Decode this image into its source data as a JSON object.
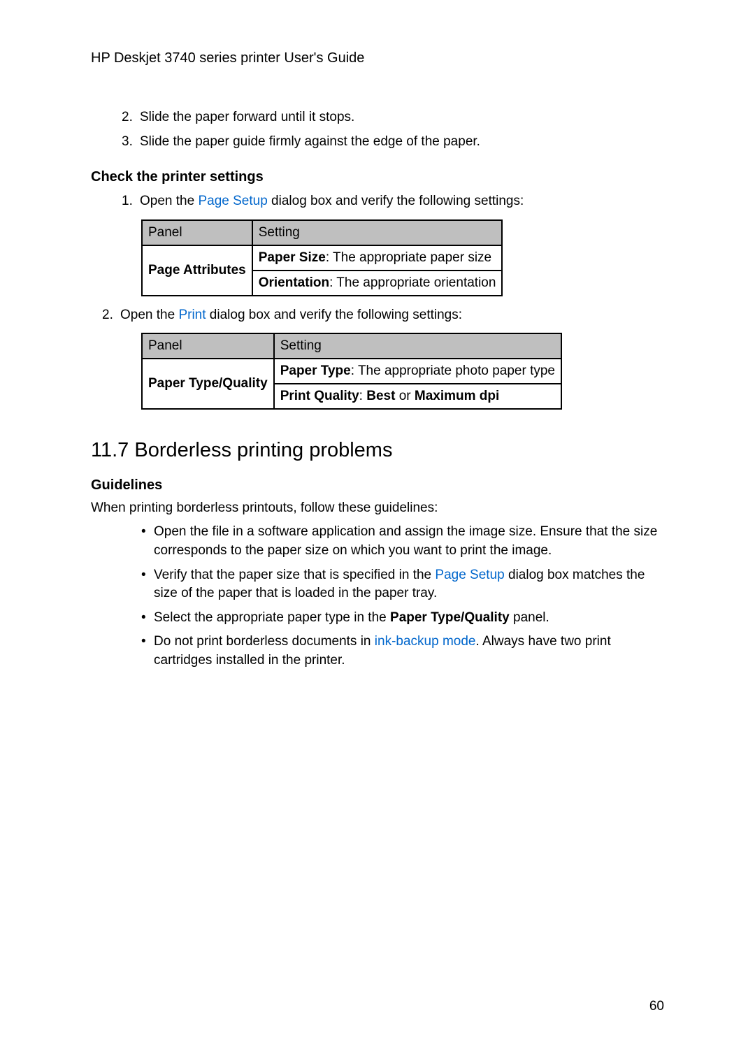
{
  "header": {
    "title": "HP Deskjet 3740 series printer User's Guide"
  },
  "list1": {
    "item2": {
      "num": "2.",
      "text": "Slide the paper forward until it stops."
    },
    "item3": {
      "num": "3.",
      "text": "Slide the paper guide firmly against the edge of the paper."
    }
  },
  "section1": {
    "heading": "Check the printer settings",
    "list": {
      "item1": {
        "num": "1.",
        "pre": "Open the ",
        "link": "Page Setup",
        "post": " dialog box and verify the following settings:"
      },
      "item2": {
        "num": "2.",
        "pre": "Open the ",
        "link": "Print",
        "post": " dialog box and verify the following settings:"
      }
    }
  },
  "table1": {
    "header": {
      "c1": "Panel",
      "c2": "Setting"
    },
    "row1_c1": "Page Attributes",
    "row1a_b": "Paper Size",
    "row1a_t": ": The appropriate paper size",
    "row1b_b": "Orientation",
    "row1b_t": ": The appropriate orientation"
  },
  "table2": {
    "header": {
      "c1": "Panel",
      "c2": "Setting"
    },
    "row1_c1": "Paper Type/Quality",
    "row1a_b": "Paper Type",
    "row1a_t": ": The appropriate photo paper type",
    "row1b_b1": "Print Quality",
    "row1b_t1": ": ",
    "row1b_b2": "Best",
    "row1b_t2": " or ",
    "row1b_b3": "Maximum dpi"
  },
  "section2": {
    "heading": "11.7  Borderless printing problems",
    "subheading": "Guidelines",
    "intro": "When printing borderless printouts, follow these guidelines:",
    "bullets": {
      "b1": "Open the file in a software application and assign the image size. Ensure that the size corresponds to the paper size on which you want to print the image.",
      "b2_pre": "Verify that the paper size that is specified in the ",
      "b2_link": "Page Setup",
      "b2_post": " dialog box matches the size of the paper that is loaded in the paper tray.",
      "b3_pre": "Select the appropriate paper type in the ",
      "b3_bold": "Paper Type/Quality",
      "b3_post": " panel.",
      "b4_pre": "Do not print borderless documents in ",
      "b4_link": "ink-backup mode",
      "b4_post": ". Always have two print cartridges installed in the printer."
    }
  },
  "pageNumber": "60",
  "chart_data": [
    {
      "type": "table",
      "title": "Page Setup settings",
      "columns": [
        "Panel",
        "Setting"
      ],
      "rows": [
        [
          "Page Attributes",
          "Paper Size: The appropriate paper size"
        ],
        [
          "Page Attributes",
          "Orientation: The appropriate orientation"
        ]
      ]
    },
    {
      "type": "table",
      "title": "Print settings",
      "columns": [
        "Panel",
        "Setting"
      ],
      "rows": [
        [
          "Paper Type/Quality",
          "Paper Type: The appropriate photo paper type"
        ],
        [
          "Paper Type/Quality",
          "Print Quality: Best or Maximum dpi"
        ]
      ]
    }
  ]
}
